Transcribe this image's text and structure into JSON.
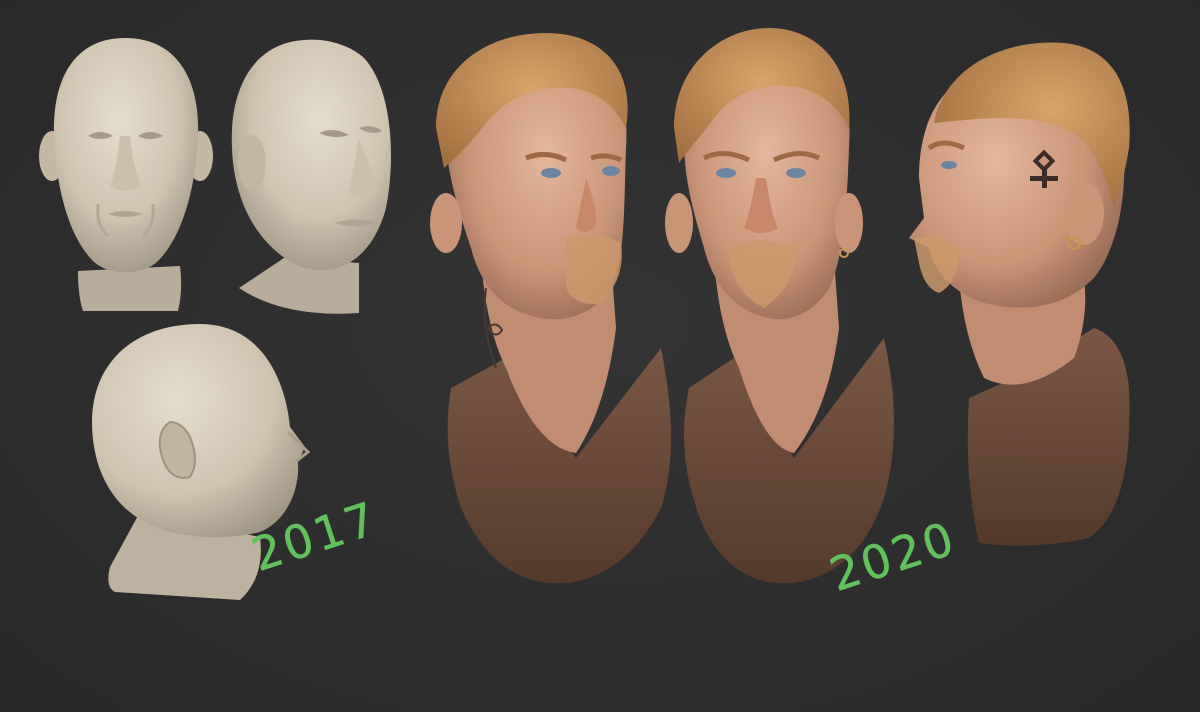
{
  "annotations": {
    "year_before": "2017",
    "year_after": "2020"
  },
  "colors": {
    "background": "#2e2e2e",
    "clay": "#d8cdbb",
    "skin": "#d9a98b",
    "hair": "#c8915a",
    "shirt": "#6a4a37",
    "annotation": "#5fc25a"
  }
}
